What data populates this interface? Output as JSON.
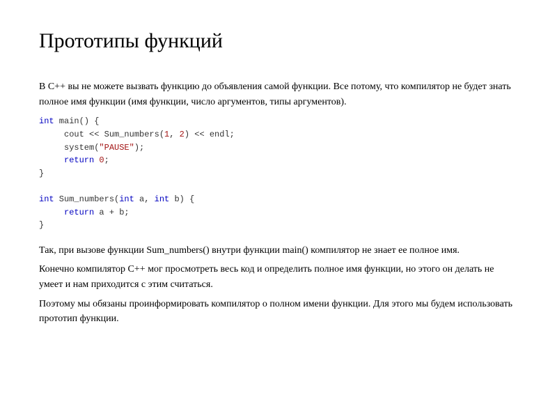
{
  "heading": "Прототипы функций",
  "paragraph1": "В C++ вы не можете вызвать функцию до объявления самой функции. Все потому, что компилятор не будет знать полное имя функции (имя функции, число аргументов, типы аргументов).",
  "code": {
    "l1a": "int",
    "l1b": " main() {",
    "l2a": "     cout << Sum_numbers(",
    "l2b": "1",
    "l2c": ", ",
    "l2d": "2",
    "l2e": ") << endl;",
    "l3a": "     system(",
    "l3b": "\"PAUSE\"",
    "l3c": ");",
    "l4a": "     return",
    "l4b": " 0",
    "l4c": ";",
    "l5": "}",
    "l6": " ",
    "l7a": "int",
    "l7b": " Sum_numbers(",
    "l7c": "int",
    "l7d": " a, ",
    "l7e": "int",
    "l7f": " b) {",
    "l8a": "     return",
    "l8b": " a + b;",
    "l9": "}"
  },
  "paragraph2": "Так, при вызове функции Sum_numbers() внутри функции main() компилятор не знает ее полное имя.",
  "paragraph3": "Конечно компилятор C++ мог просмотреть весь код и определить полное имя функции, но этого он делать не умеет и нам приходится с этим считаться.",
  "paragraph4": "Поэтому мы обязаны проинформировать компилятор о полном имени функции. Для этого мы будем использовать прототип функции."
}
